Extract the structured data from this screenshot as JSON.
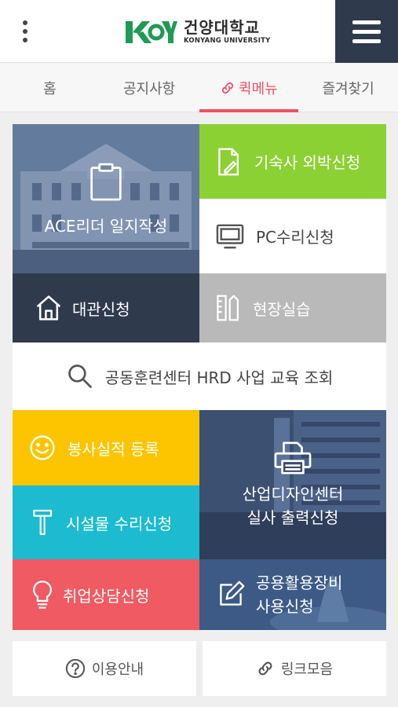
{
  "header": {
    "logo": {
      "mark": "KY",
      "name_ko": "건양대학교",
      "name_en": "KONYANG UNIVERSITY",
      "brand_color": "#1e9a55"
    },
    "menu_icon": "hamburger-icon",
    "more_icon": "kebab-icon"
  },
  "tabs": [
    {
      "label": "홈"
    },
    {
      "label": "공지사항"
    },
    {
      "label": "퀵메뉴",
      "icon": "link-icon",
      "active": true
    },
    {
      "label": "즐겨찾기"
    }
  ],
  "tiles": {
    "ace": {
      "label": "ACE리더 일지작성",
      "icon": "clipboard-icon"
    },
    "dorm": {
      "label": "기숙사 외박신청",
      "icon": "document-pen-icon"
    },
    "pc": {
      "label": "PC수리신청",
      "icon": "monitor-icon"
    },
    "rent": {
      "label": "대관신청",
      "icon": "house-icon"
    },
    "field": {
      "label": "현장실습",
      "icon": "ruler-pencil-icon"
    },
    "hrd": {
      "label": "공동훈련센터 HRD 사업 교육 조회",
      "icon": "search-icon"
    },
    "vol": {
      "label": "봉사실적 등록",
      "icon": "smile-icon"
    },
    "fac": {
      "label": "시설물 수리신청",
      "icon": "hammer-icon"
    },
    "job": {
      "label": "취업상담신청",
      "icon": "lightbulb-icon"
    },
    "design": {
      "line1": "산업디자인센터",
      "line2": "실사 출력신청",
      "icon": "printer-icon"
    },
    "equip": {
      "line1": "공용활용장비",
      "line2": "사용신청",
      "icon": "edit-icon"
    }
  },
  "bottom": {
    "guide": {
      "label": "이용안내",
      "icon": "question-circle-icon"
    },
    "links": {
      "label": "링크모음",
      "icon": "link-icon"
    }
  },
  "colors": {
    "accent": "#ef5064",
    "navy": "#2f3b4d",
    "green": "#8cd133",
    "yellow": "#fcc500",
    "cyan": "#1cbbd0",
    "red": "#f05a62",
    "gray": "#b9b9b9"
  }
}
